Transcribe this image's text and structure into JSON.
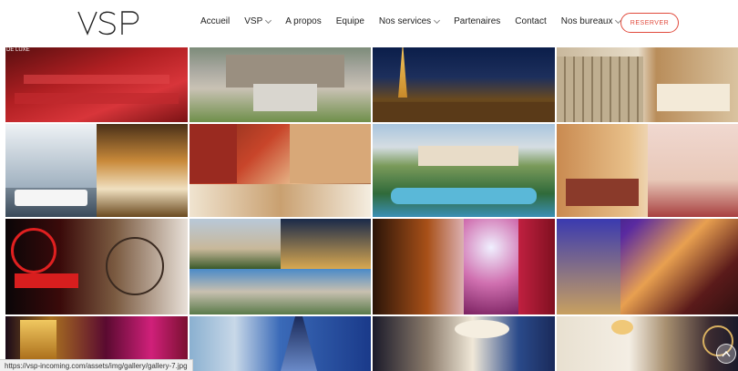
{
  "brand": {
    "logo_text": "VSP"
  },
  "nav": {
    "items": [
      {
        "label": "Accueil",
        "dropdown": false
      },
      {
        "label": "VSP",
        "dropdown": true
      },
      {
        "label": "A propos",
        "dropdown": false
      },
      {
        "label": "Equipe",
        "dropdown": false
      },
      {
        "label": "Nos services",
        "dropdown": true
      },
      {
        "label": "Partenaires",
        "dropdown": false
      },
      {
        "label": "Contact",
        "dropdown": false
      },
      {
        "label": "Nos bureaux",
        "dropdown": true
      }
    ],
    "cta_label": "RESERVER"
  },
  "colors": {
    "accent": "#e14a3c"
  },
  "gallery": {
    "first_tile_caption": "DE LUXE",
    "tiles": [
      {
        "scene": "red theatre seats"
      },
      {
        "scene": "chateau aerial"
      },
      {
        "scene": "eiffel tower night terrace"
      },
      {
        "scene": "paris street and hotel room"
      },
      {
        "scene": "champagne and river boat"
      },
      {
        "scene": "dining room and paris events"
      },
      {
        "scene": "resort with pools"
      },
      {
        "scene": "hotel suite bedroom"
      },
      {
        "scene": "moulin rouge and hotel room"
      },
      {
        "scene": "chateaux collage"
      },
      {
        "scene": "cabaret show"
      },
      {
        "scene": "hotel facade and theatre"
      },
      {
        "scene": "galeries lafayette and eiffel tower"
      },
      {
        "scene": "lobby and grand staircase"
      },
      {
        "scene": "hotel room with chandelier"
      }
    ]
  },
  "status_bar": {
    "url": "https://vsp-incoming.com/assets/img/gallery/gallery-7.jpg"
  }
}
